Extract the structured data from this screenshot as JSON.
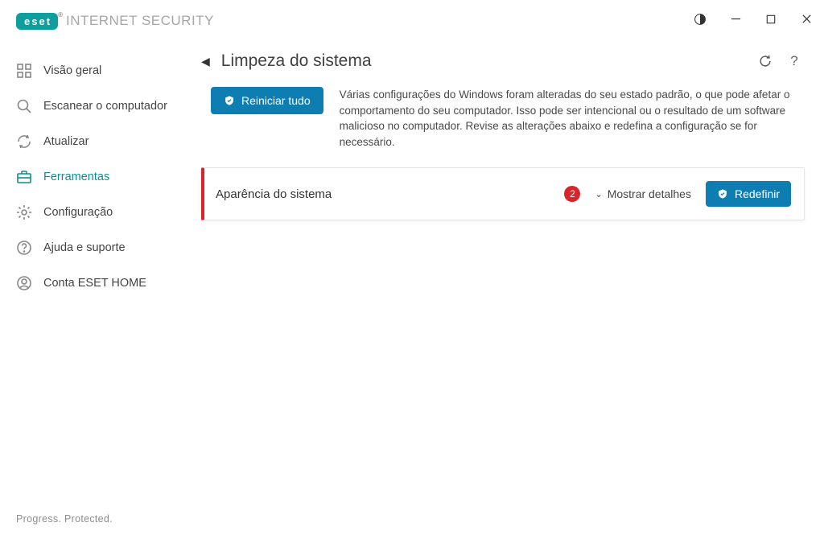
{
  "brand": {
    "logo_text": "eset",
    "name": "INTERNET SECURITY"
  },
  "sidebar": {
    "items": [
      {
        "label": "Visão geral",
        "icon": "grid-icon"
      },
      {
        "label": "Escanear o computador",
        "icon": "search-icon"
      },
      {
        "label": "Atualizar",
        "icon": "refresh-icon"
      },
      {
        "label": "Ferramentas",
        "icon": "briefcase-icon",
        "active": true
      },
      {
        "label": "Configuração",
        "icon": "gear-icon"
      },
      {
        "label": "Ajuda e suporte",
        "icon": "help-icon"
      },
      {
        "label": "Conta ESET HOME",
        "icon": "user-icon"
      }
    ]
  },
  "page": {
    "title": "Limpeza do sistema",
    "reset_all_label": "Reiniciar tudo",
    "description": "Várias configurações do Windows foram alteradas do seu estado padrão, o que pode afetar o comportamento do seu computador. Isso pode ser intencional ou o resultado de um software malicioso no computador. Revise as alterações abaixo e redefina a configuração se for necessário."
  },
  "card": {
    "title": "Aparência do sistema",
    "badge": "2",
    "details_label": "Mostrar detalhes",
    "reset_label": "Redefinir",
    "severity_color": "#d8252c"
  },
  "footer": {
    "tagline": "Progress. Protected."
  }
}
